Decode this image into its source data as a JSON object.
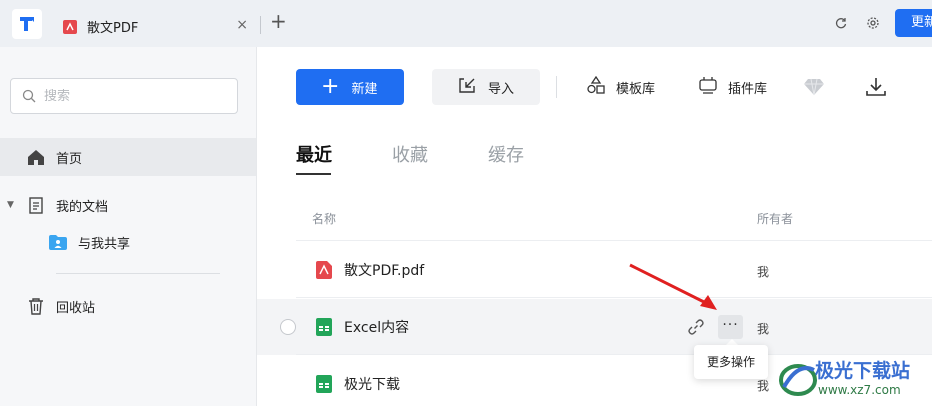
{
  "titlebar": {
    "tab_label": "散文PDF",
    "tab_close": "×",
    "tab_add": "+",
    "update_label": "更新",
    "icons": [
      "refresh-icon",
      "settings-icon"
    ]
  },
  "sidebar": {
    "search_placeholder": "搜索",
    "items": [
      {
        "label": "首页",
        "icon": "home-icon"
      },
      {
        "label": "我的文档",
        "icon": "document-icon"
      },
      {
        "label": "与我共享",
        "icon": "shared-folder-icon"
      },
      {
        "label": "回收站",
        "icon": "trash-icon"
      }
    ]
  },
  "toolbar": {
    "new_label": "新建",
    "import_label": "导入",
    "template_label": "模板库",
    "plugin_label": "插件库",
    "icons": [
      "diamond-icon",
      "download-icon"
    ]
  },
  "tabs": [
    {
      "label": "最近",
      "active": true
    },
    {
      "label": "收藏",
      "active": false
    },
    {
      "label": "缓存",
      "active": false
    }
  ],
  "table": {
    "headers": {
      "name": "名称",
      "owner": "所有者"
    },
    "rows": [
      {
        "name": "散文PDF.pdf",
        "owner": "我",
        "type": "pdf"
      },
      {
        "name": "Excel内容",
        "owner": "我",
        "type": "sheet"
      },
      {
        "name": "极光下载",
        "owner": "我",
        "type": "sheet"
      }
    ],
    "more_label": "···"
  },
  "tooltip": {
    "text": "更多操作"
  },
  "watermark": {
    "text": "极光下载站",
    "url": "www.xz7.com"
  },
  "colors": {
    "accent": "#1f6ef2",
    "pdf_red": "#e5484d",
    "sheet_green": "#22a559",
    "arrow_red": "#e02020"
  }
}
